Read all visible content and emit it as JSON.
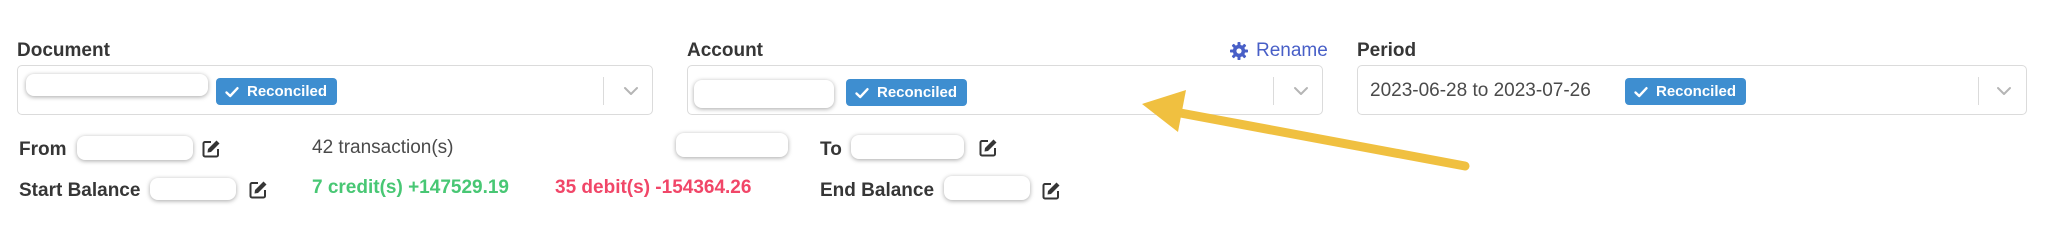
{
  "document": {
    "label": "Document",
    "badge": "Reconciled"
  },
  "account": {
    "label": "Account",
    "rename_label": "Rename",
    "badge": "Reconciled"
  },
  "period": {
    "label": "Period",
    "value": "2023-06-28 to 2023-07-26",
    "badge": "Reconciled"
  },
  "summary": {
    "from_label": "From",
    "start_balance_label": "Start Balance",
    "transactions": "42 transaction(s)",
    "credits": "7 credit(s) +147529.19",
    "debits": "35 debit(s) -154364.26",
    "to_label": "To",
    "end_balance_label": "End Balance"
  },
  "colors": {
    "badge": "#3e8ed0",
    "credit": "#48c774",
    "debit": "#f14668",
    "link": "#485fc7",
    "arrow": "#f0c040"
  },
  "icons": {
    "check": "check-icon",
    "chevron": "chevron-down-icon",
    "gear": "gear-icon",
    "edit": "edit-icon",
    "arrow": "arrow-annotation"
  }
}
